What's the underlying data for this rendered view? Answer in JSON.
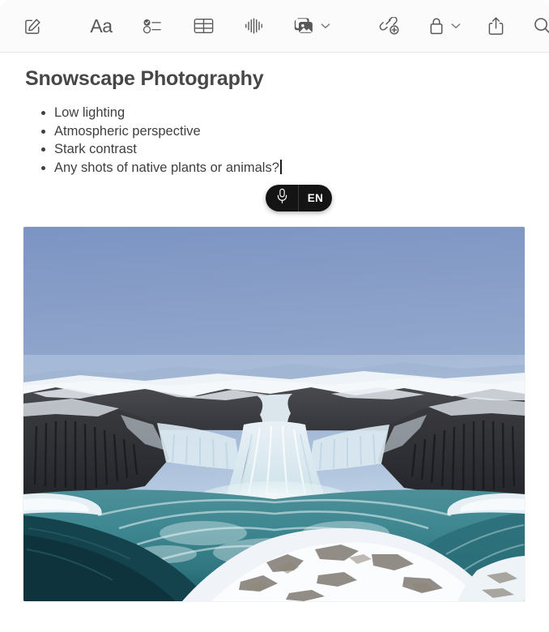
{
  "window": {
    "app": "Notes"
  },
  "toolbar": {
    "left_items": [
      {
        "name": "compose-note-button",
        "icon": "compose-icon",
        "label": "New Note"
      }
    ],
    "center_items": [
      {
        "name": "format-button",
        "icon": "format-aa-icon",
        "label": "Aa"
      },
      {
        "name": "checklist-button",
        "icon": "checklist-icon",
        "label": "Checklist"
      },
      {
        "name": "table-button",
        "icon": "table-icon",
        "label": "Table"
      },
      {
        "name": "audio-button",
        "icon": "audio-waveform-icon",
        "label": "Record Audio"
      },
      {
        "name": "media-button",
        "icon": "media-photo-icon",
        "label": "Media",
        "has_chevron": true
      }
    ],
    "right_items": [
      {
        "name": "add-link-button",
        "icon": "link-add-icon",
        "label": "Add Link"
      },
      {
        "name": "lock-button",
        "icon": "lock-icon",
        "label": "Lock Note",
        "has_chevron": true
      },
      {
        "name": "share-button",
        "icon": "share-icon",
        "label": "Share"
      },
      {
        "name": "search-button",
        "icon": "search-icon",
        "label": "Search"
      }
    ],
    "chevron_glyph": "chevron-down-icon"
  },
  "note": {
    "title": "Snowscape Photography",
    "bullets": [
      {
        "text": "Low lighting",
        "caret": false
      },
      {
        "text": "Atmospheric perspective",
        "caret": false
      },
      {
        "text": "Stark contrast",
        "caret": false
      },
      {
        "text": "Any shots of native plants or animals?",
        "caret": true
      }
    ]
  },
  "dictation": {
    "mic_icon": "microphone-icon",
    "language": "EN",
    "background_color": "#141414",
    "text_color": "#ffffff"
  },
  "attachment": {
    "name": "snowscape-waterfall-photo",
    "alt": "Frozen waterfall in a snowy basalt canyon with teal water under a blue sky",
    "colors": {
      "sky_top": "#7e96c4",
      "sky_bottom": "#cfe0ef",
      "water_teal": "#3f8893",
      "water_dark": "#16454f",
      "rock_dark": "#2e3036",
      "snow": "#f1f4f8"
    }
  },
  "theme": {
    "toolbar_background": "#fbfbfb",
    "page_background": "#ffffff",
    "icon_color": "#58585a",
    "title_color": "#474747",
    "body_text_color": "#3f3f41",
    "separator_color": "#e6e6e6"
  }
}
